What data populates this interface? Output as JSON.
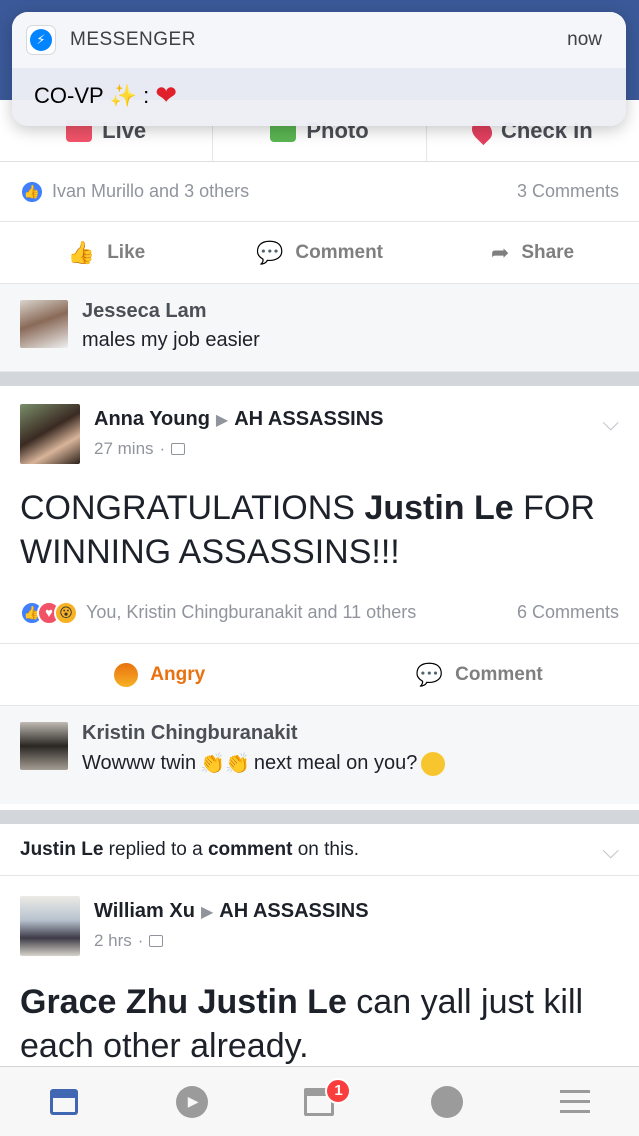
{
  "notification": {
    "app": "MESSENGER",
    "time": "now",
    "sender": "CO-VP",
    "message_suffix": ":"
  },
  "composer": {
    "items": [
      {
        "label": "Live"
      },
      {
        "label": "Photo"
      },
      {
        "label": "Check In"
      }
    ]
  },
  "post1": {
    "reactions_text": "Ivan Murillo and 3 others",
    "comments_count": "3 Comments",
    "actions": {
      "like": "Like",
      "comment": "Comment",
      "share": "Share"
    },
    "comment": {
      "name": "Jesseca Lam",
      "text": "males my job easier"
    }
  },
  "post2": {
    "author": "Anna Young",
    "group": "AH ASSASSINS",
    "time": "27 mins",
    "text_pre": "CONGRATULATIONS ",
    "text_bold": "Justin Le",
    "text_post": " FOR WINNING ASSASSINS!!!",
    "reactions_text": "You, Kristin Chingburanakit and 11 others",
    "comments_count": "6 Comments",
    "actions": {
      "angry": "Angry",
      "comment": "Comment"
    },
    "comment": {
      "name": "Kristin Chingburanakit",
      "text_pre": "Wowww twin",
      "text_post": "next meal on you?"
    }
  },
  "post3": {
    "note_name": "Justin Le",
    "note_mid1": " replied to a ",
    "note_bold": "comment",
    "note_end": " on this.",
    "author": "William Xu",
    "group": "AH ASSASSINS",
    "time": "2 hrs",
    "text_bold": "Grace Zhu Justin Le",
    "text_post": " can yall just kill each other already."
  },
  "tabbar": {
    "badge": "1"
  },
  "colors": {
    "brand": "#3b5998",
    "messenger": "#0084ff",
    "angry": "#e9710f",
    "badge": "#fa3e3e"
  }
}
